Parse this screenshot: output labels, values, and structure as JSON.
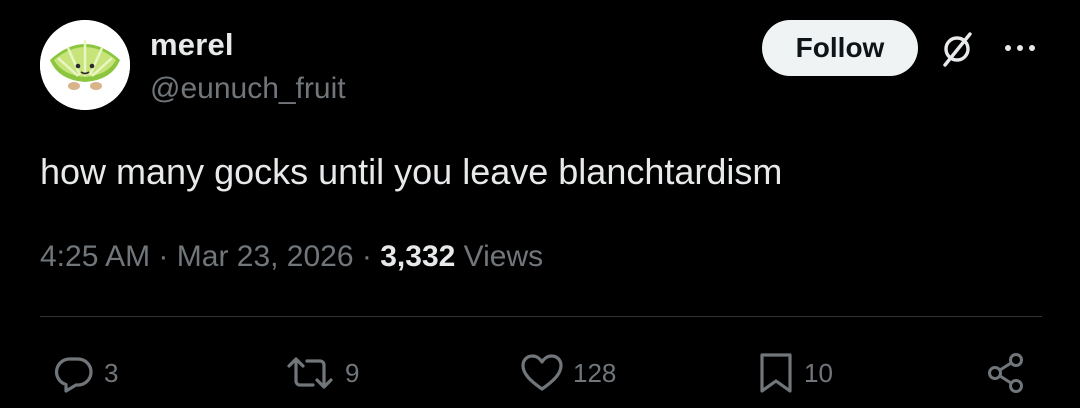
{
  "author": {
    "display_name": "merel",
    "handle": "@eunuch_fruit",
    "avatar_icon": "lime-plush-avatar"
  },
  "header": {
    "follow_label": "Follow",
    "grok_icon": "grok-icon",
    "more_icon": "more-icon"
  },
  "tweet": {
    "text": "how many gocks until you leave blanchtardism",
    "time": "4:25 AM",
    "separator": "·",
    "date": "Mar 23, 2026",
    "views_count": "3,332",
    "views_label": "Views"
  },
  "actions": {
    "replies": "3",
    "retweets": "9",
    "likes": "128",
    "bookmarks": "10"
  },
  "colors": {
    "background": "#000000",
    "primary_text": "#e7e9ea",
    "secondary_text": "#71767b",
    "divider": "#2f3336",
    "follow_bg": "#eff3f4",
    "follow_text": "#0f1419"
  }
}
